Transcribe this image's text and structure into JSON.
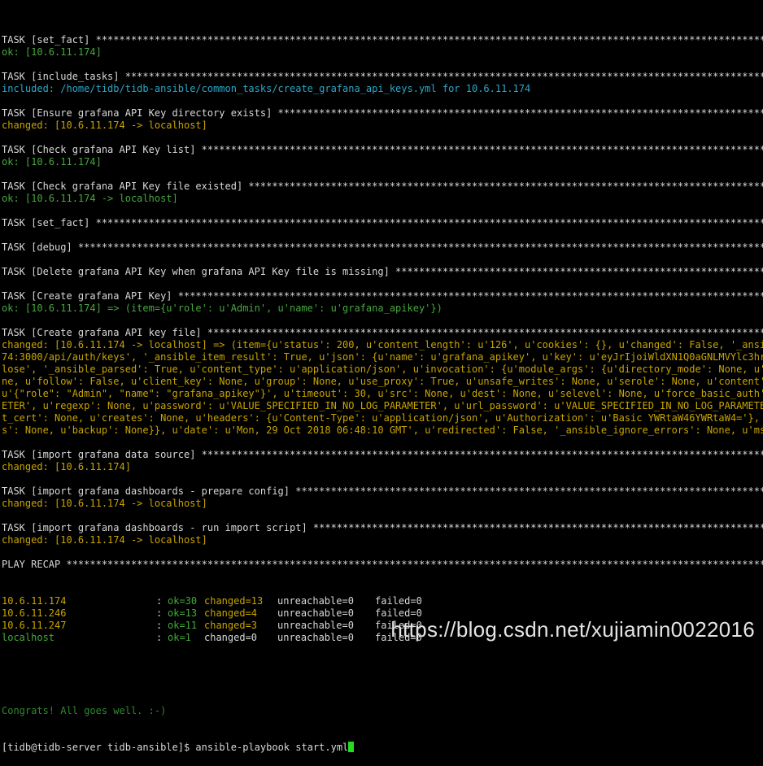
{
  "terminal": {
    "lines": [
      {
        "text": "TASK [set_fact] ******************************************************************************************************************************",
        "color": "w"
      },
      {
        "text": "ok: [10.6.11.174]",
        "color": "g"
      },
      {
        "text": "",
        "color": "w"
      },
      {
        "text": "TASK [include_tasks] *************************************************************************************************************************",
        "color": "w"
      },
      {
        "text": "included: /home/tidb/tidb-ansible/common_tasks/create_grafana_api_keys.yml for 10.6.11.174",
        "color": "c"
      },
      {
        "text": "",
        "color": "w"
      },
      {
        "text": "TASK [Ensure grafana API Key directory exists] *******************************************************************************************",
        "color": "w"
      },
      {
        "text": "changed: [10.6.11.174 -> localhost]",
        "color": "y"
      },
      {
        "text": "",
        "color": "w"
      },
      {
        "text": "TASK [Check grafana API Key list] ********************************************************************************************************",
        "color": "w"
      },
      {
        "text": "ok: [10.6.11.174]",
        "color": "g"
      },
      {
        "text": "",
        "color": "w"
      },
      {
        "text": "TASK [Check grafana API Key file existed] ************************************************************************************************",
        "color": "w"
      },
      {
        "text": "ok: [10.6.11.174 -> localhost]",
        "color": "g"
      },
      {
        "text": "",
        "color": "w"
      },
      {
        "text": "TASK [set_fact] ******************************************************************************************************************************",
        "color": "w"
      },
      {
        "text": "",
        "color": "w"
      },
      {
        "text": "TASK [debug] *********************************************************************************************************************************",
        "color": "w"
      },
      {
        "text": "",
        "color": "w"
      },
      {
        "text": "TASK [Delete grafana API Key when grafana API Key file is missing] *******************************************************************",
        "color": "w"
      },
      {
        "text": "",
        "color": "w"
      },
      {
        "text": "TASK [Create grafana API Key] ************************************************************************************************************",
        "color": "w"
      },
      {
        "text": "ok: [10.6.11.174] => (item={u'role': u'Admin', u'name': u'grafana_apikey'})",
        "color": "g"
      },
      {
        "text": "",
        "color": "w"
      },
      {
        "text": "TASK [Create grafana API key file] *******************************************************************************************************",
        "color": "w"
      },
      {
        "text": "changed: [10.6.11.174 -> localhost] => (item={u'status': 200, u'content_length': u'126', u'cookies': {}, u'changed': False, '_ansible_",
        "color": "y"
      },
      {
        "text": "74:3000/api/auth/keys', '_ansible_item_result': True, u'json': {u'name': u'grafana_apikey', u'key': u'eyJrIjoiWldXN1Q0aGNLMVYlc3hrSlFT",
        "color": "y"
      },
      {
        "text": "lose', '_ansible_parsed': True, u'content_type': u'application/json', u'invocation': {u'module_args': {u'directory_mode': None, u'forc",
        "color": "y"
      },
      {
        "text": "ne, u'follow': False, u'client_key': None, u'group': None, u'use_proxy': True, u'unsafe_writes': None, u'serole': None, u'content': No",
        "color": "y"
      },
      {
        "text": "u'{\"role\": \"Admin\", \"name\": \"grafana_apikey\"}', u'timeout': 30, u'src': None, u'dest': None, u'selevel': None, u'force_basic_auth': Tr",
        "color": "y"
      },
      {
        "text": "ETER', u'regexp': None, u'password': u'VALUE_SPECIFIED_IN_NO_LOG_PARAMETER', u'url_password': u'VALUE_SPECIFIED_IN_NO_LOG_PARAMETER',",
        "color": "y"
      },
      {
        "text": "t_cert': None, u'creates': None, u'headers': {u'Content-Type': u'application/json', u'Authorization': u'Basic YWRtaW46YWRtaW4='}, u'de",
        "color": "y"
      },
      {
        "text": "s': None, u'backup': None}}, u'date': u'Mon, 29 Oct 2018 06:48:10 GMT', u'redirected': False, '_ansible_ignore_errors': None, u'msg':",
        "color": "y"
      },
      {
        "text": "",
        "color": "w"
      },
      {
        "text": "TASK [import grafana data source] ********************************************************************************************************",
        "color": "w"
      },
      {
        "text": "changed: [10.6.11.174]",
        "color": "y"
      },
      {
        "text": "",
        "color": "w"
      },
      {
        "text": "TASK [import grafana dashboards - prepare config] ************************************************************************************",
        "color": "w"
      },
      {
        "text": "changed: [10.6.11.174 -> localhost]",
        "color": "y"
      },
      {
        "text": "",
        "color": "w"
      },
      {
        "text": "TASK [import grafana dashboards - run import script] *********************************************************************************",
        "color": "w"
      },
      {
        "text": "changed: [10.6.11.174 -> localhost]",
        "color": "y"
      },
      {
        "text": "",
        "color": "w"
      },
      {
        "text": "PLAY RECAP ***********************************************************************************************************************************",
        "color": "w"
      }
    ],
    "recap": [
      {
        "host": "10.6.11.174",
        "host_color": "y",
        "ok": "ok=30",
        "ok_color": "g",
        "changed": "changed=13",
        "changed_color": "y",
        "unreachable": "unreachable=0",
        "failed": "failed=0"
      },
      {
        "host": "10.6.11.246",
        "host_color": "y",
        "ok": "ok=13",
        "ok_color": "g",
        "changed": "changed=4",
        "changed_color": "y",
        "unreachable": "unreachable=0",
        "failed": "failed=0"
      },
      {
        "host": "10.6.11.247",
        "host_color": "y",
        "ok": "ok=11",
        "ok_color": "g",
        "changed": "changed=3",
        "changed_color": "y",
        "unreachable": "unreachable=0",
        "failed": "failed=0"
      },
      {
        "host": "localhost",
        "host_color": "g",
        "ok": "ok=1",
        "ok_color": "g",
        "changed": "changed=0",
        "changed_color": "w",
        "unreachable": "unreachable=0",
        "failed": "failed=0"
      }
    ],
    "congrats": "Congrats! All goes well. :-)",
    "prompt": "[tidb@tidb-server tidb-ansible]$ ",
    "command": "ansible-playbook start.yml"
  },
  "watermark": "https://blog.csdn.net/xujiamin0022016",
  "colors": {
    "background": "#000000",
    "white": "#d8d8d8",
    "green": "#46a83c",
    "yellow": "#c8a400",
    "cyan": "#2aa8c8",
    "dim_green": "#2e8a2e",
    "cursor": "#22dd22"
  }
}
